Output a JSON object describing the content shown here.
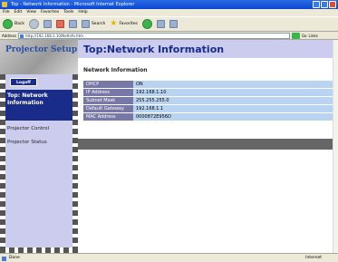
{
  "window": {
    "title": "Top - Network Information - Microsoft Internet Explorer"
  },
  "menu": [
    "File",
    "Edit",
    "View",
    "Favorites",
    "Tools",
    "Help"
  ],
  "toolbar": {
    "back": "Back",
    "search": "Search",
    "favorites": "Favorites"
  },
  "address": {
    "label": "Address",
    "url": "http://192.168.1.10/NetInfo.htm",
    "go": "Go",
    "links": "Links"
  },
  "sidebar": {
    "logo": "Projector Setup",
    "logout": "Logoff",
    "active_item": "Top: Network Information",
    "items": [
      "Projector Control",
      "Projector Status"
    ]
  },
  "page": {
    "title": "Top:Network Information",
    "section": "Network Information"
  },
  "network_info": [
    {
      "label": "DHCP",
      "value": "ON"
    },
    {
      "label": "IP Address",
      "value": "192.168.1.10"
    },
    {
      "label": "Subnet Mask",
      "value": "255.255.255.0"
    },
    {
      "label": "Default Gateway",
      "value": "192.168.1.1"
    },
    {
      "label": "MAC Address",
      "value": "0000872E956D"
    }
  ],
  "status": {
    "left": "Done",
    "zone": "Internet"
  },
  "colors": {
    "nav_active": "#1a2c8a",
    "table_label": "#7878a8",
    "table_value": "#b8d4f0",
    "band": "#ccccee"
  }
}
